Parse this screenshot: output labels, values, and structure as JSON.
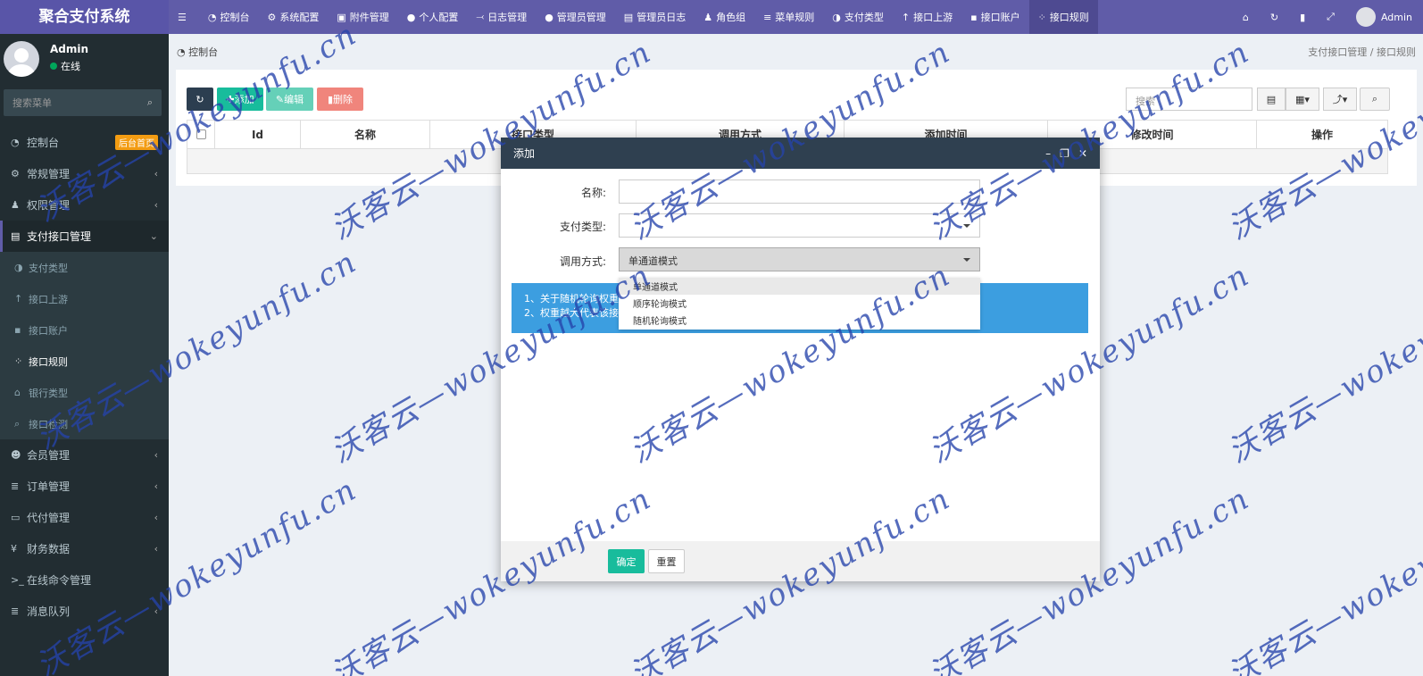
{
  "app_title": "聚合支付系统",
  "topnav": {
    "items": [
      {
        "icon": "menu-icon",
        "label": ""
      },
      {
        "icon": "dashboard-icon",
        "label": "控制台"
      },
      {
        "icon": "gear-icon",
        "label": "系统配置"
      },
      {
        "icon": "file-icon",
        "label": "附件管理"
      },
      {
        "icon": "user-icon",
        "label": "个人配置"
      },
      {
        "icon": "log-icon",
        "label": "日志管理"
      },
      {
        "icon": "user-icon",
        "label": "管理员管理"
      },
      {
        "icon": "list-icon",
        "label": "管理员日志"
      },
      {
        "icon": "group-icon",
        "label": "角色组"
      },
      {
        "icon": "bars-icon",
        "label": "菜单规则"
      },
      {
        "icon": "globe-icon",
        "label": "支付类型"
      },
      {
        "icon": "arrow-up-icon",
        "label": "接口上游"
      },
      {
        "icon": "account-icon",
        "label": "接口账户"
      },
      {
        "icon": "grid-icon",
        "label": "接口规则"
      }
    ],
    "user_name": "Admin"
  },
  "sidebar": {
    "user_name": "Admin",
    "status": "在线",
    "search_placeholder": "搜索菜单",
    "badge": "后台首页",
    "items": [
      {
        "label": "控制台"
      },
      {
        "label": "常规管理"
      },
      {
        "label": "权限管理"
      },
      {
        "label": "支付接口管理"
      }
    ],
    "sub_items": [
      {
        "label": "支付类型"
      },
      {
        "label": "接口上游"
      },
      {
        "label": "接口账户"
      },
      {
        "label": "接口规则"
      },
      {
        "label": "银行类型"
      },
      {
        "label": "接口检测"
      }
    ],
    "items_after": [
      {
        "label": "会员管理"
      },
      {
        "label": "订单管理"
      },
      {
        "label": "代付管理"
      },
      {
        "label": "财务数据"
      },
      {
        "label": "在线命令管理"
      },
      {
        "label": "消息队列"
      }
    ]
  },
  "breadcrumb": {
    "left": "控制台",
    "right_1": "支付接口管理",
    "separator": "/",
    "right_2": "接口规则"
  },
  "toolbar": {
    "refresh": "",
    "add": "添加",
    "edit": "编辑",
    "delete": "删除",
    "search_placeholder": "搜索"
  },
  "table": {
    "columns": [
      "Id",
      "名称",
      "接口类型",
      "调用方式",
      "添加时间",
      "修改时间",
      "操作"
    ]
  },
  "modal": {
    "title": "添加",
    "labels": {
      "name": "名称:",
      "pay_type": "支付类型:",
      "call_mode": "调用方式:"
    },
    "name_value": "",
    "pay_type_value": "",
    "call_mode_value": "单通道模式",
    "tip_line_1": "1、关于随机轮询权重",
    "tip_line_2": "2、权重越大代表该接",
    "options": [
      "单通道模式",
      "顺序轮询模式",
      "随机轮询模式"
    ],
    "confirm": "确定",
    "reset": "重置"
  },
  "watermark": "沃客云—wokeyunfu.cn",
  "colors": {
    "nav": "#605ca8",
    "sidebar": "#222d32",
    "add": "#18bc9c",
    "edit": "#65d0b8",
    "delete": "#f0857c",
    "tip": "#3c9ee0",
    "confirm": "#18bc9c"
  }
}
